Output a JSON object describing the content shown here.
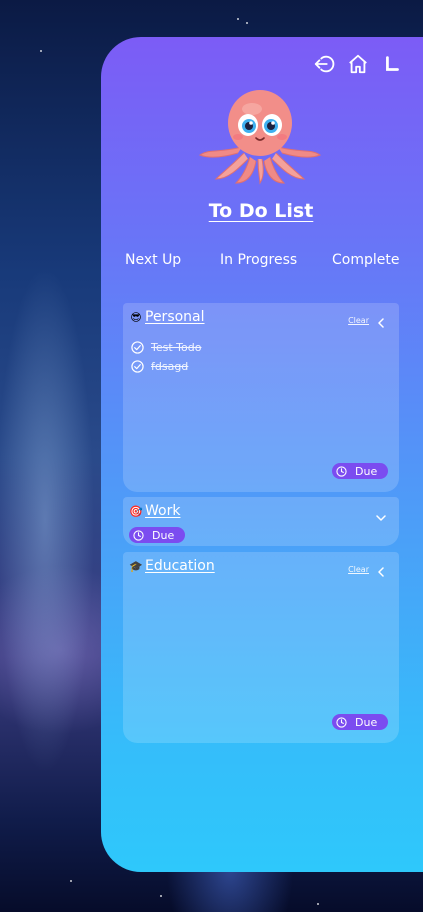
{
  "header": {
    "icons": [
      "logout-icon",
      "home-icon",
      "l-shape-icon"
    ]
  },
  "app": {
    "title": "To Do List"
  },
  "tabs": [
    {
      "label": "Next Up"
    },
    {
      "label": "In Progress"
    },
    {
      "label": "Complete"
    }
  ],
  "categories": [
    {
      "emoji": "😎",
      "name": "Personal",
      "clear_label": "Clear",
      "expanded": true,
      "todos": [
        {
          "text": "Test Todo",
          "done": true
        },
        {
          "text": "fdsagd",
          "done": true
        }
      ],
      "due_label": "Due"
    },
    {
      "emoji": "🎯",
      "name": "Work",
      "expanded": false,
      "due_label": "Due"
    },
    {
      "emoji": "🎓",
      "name": "Education",
      "clear_label": "Clear",
      "expanded": true,
      "todos": [],
      "due_label": "Due"
    }
  ],
  "colors": {
    "card_top": "#7c5cf6",
    "card_bottom": "#2ec8fb",
    "due_badge": "#7b4cf0"
  }
}
